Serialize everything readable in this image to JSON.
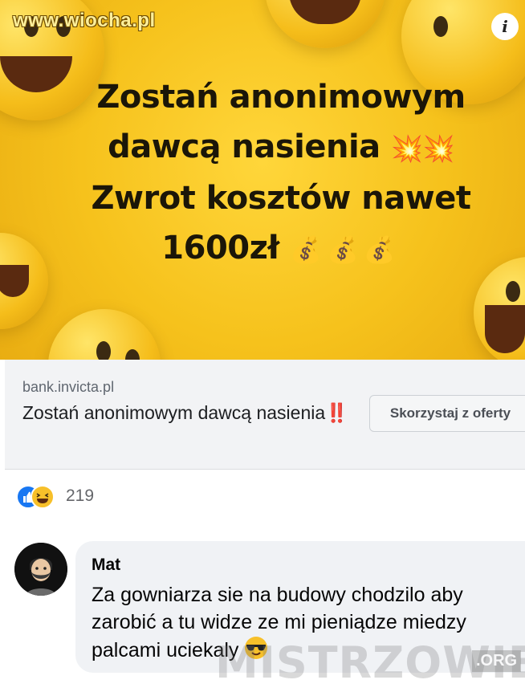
{
  "watermark": {
    "site": "www.wiocha.pl",
    "bottom": "MISTRZOWIE",
    "bottom_suffix": ".ORG"
  },
  "ad": {
    "info_icon": "i",
    "headline": [
      {
        "text": "Zostań anonimowym",
        "emoji": ""
      },
      {
        "text": "dawcą nasienia",
        "emoji": "💥💥"
      },
      {
        "text": "Zwrot kosztów nawet",
        "emoji": ""
      },
      {
        "text": "1600zł",
        "emoji": "💰💰💰"
      }
    ]
  },
  "link_card": {
    "domain": "bank.invicta.pl",
    "title": "Zostań anonimowym dawcą nasienia",
    "title_emoji": "‼️",
    "cta_label": "Skorzystaj z oferty"
  },
  "reactions": {
    "icons": [
      "like-icon",
      "haha-icon"
    ],
    "count": "219"
  },
  "comment": {
    "author": "Mat",
    "text": "Za gowniarza sie na budowy chodzilo aby zarobić a tu widze ze mi pieniądze miedzy palcami uciekaly",
    "emoji": "sunglasses-face"
  },
  "colors": {
    "banner_yellow": "#f6c21c",
    "link_blue": "#1877f2",
    "card_gray": "#f2f3f5"
  }
}
